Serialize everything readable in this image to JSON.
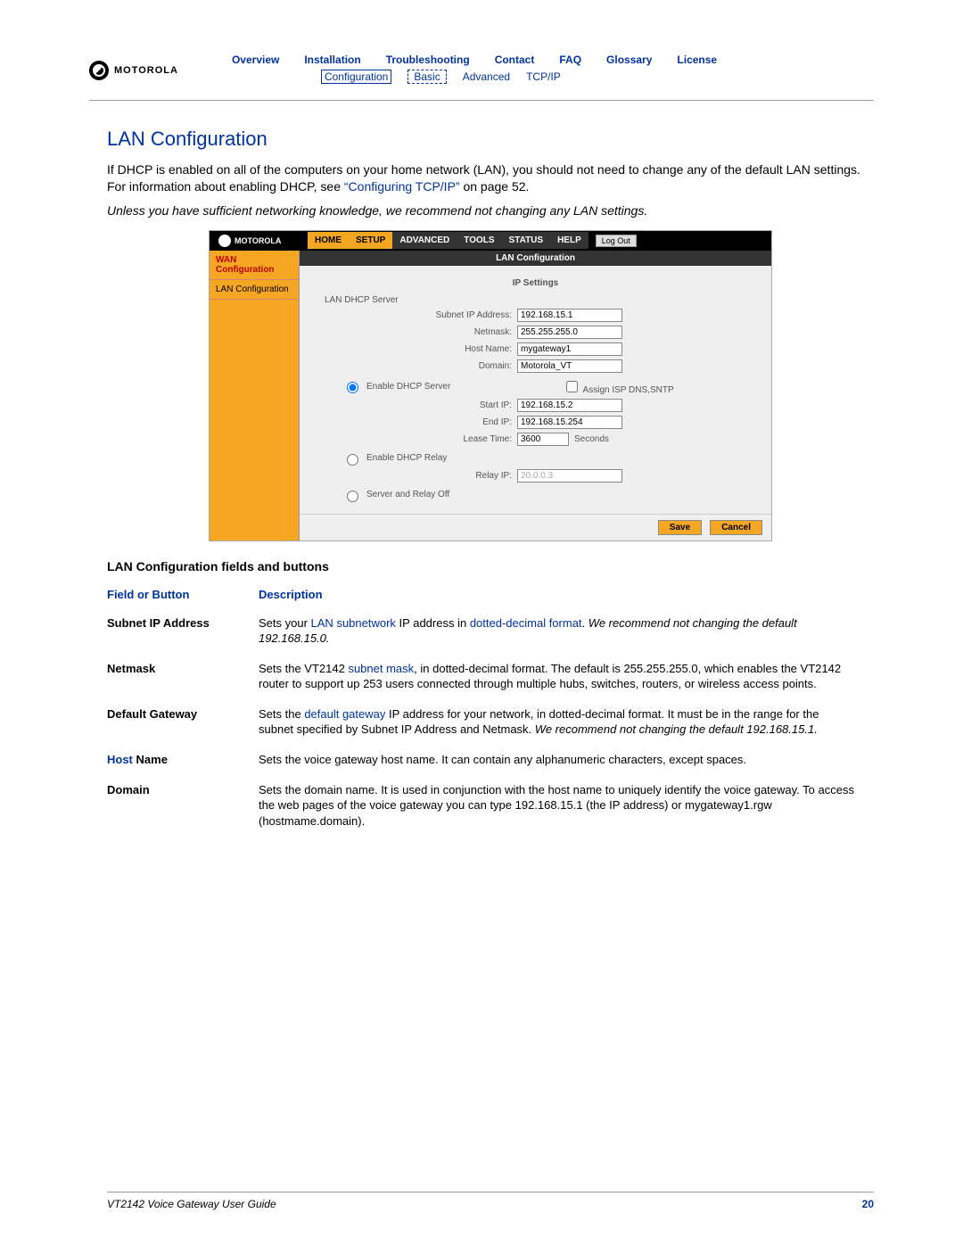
{
  "brand": "MOTOROLA",
  "nav": {
    "row1": [
      "Overview",
      "Installation",
      "Troubleshooting",
      "Contact",
      "FAQ",
      "Glossary",
      "License"
    ],
    "row2": {
      "configuration": "Configuration",
      "basic": "Basic",
      "advanced": "Advanced",
      "tcpip": "TCP/IP"
    }
  },
  "title": "LAN Configuration",
  "intro1a": "If DHCP is enabled on all of the computers on your home network (LAN), you should not need to change any of the default LAN settings. For information about enabling DHCP, see ",
  "intro1_link": "“Configuring TCP/IP”",
  "intro1b": " on page 52.",
  "intro2": "Unless you have sufficient networking knowledge, we recommend not changing any LAN settings.",
  "screenshot": {
    "brand": "MOTOROLA",
    "tabs": {
      "home": "HOME",
      "setup": "SETUP",
      "advanced": "ADVANCED",
      "tools": "TOOLS",
      "status": "STATUS",
      "help": "HELP"
    },
    "logout": "Log Out",
    "side": {
      "wan": "WAN Configuration",
      "lan": "LAN Configuration"
    },
    "panel_title": "LAN Configuration",
    "section1": "IP Settings",
    "lan_dhcp_server": "LAN DHCP Server",
    "labels": {
      "subnet": "Subnet IP Address:",
      "netmask": "Netmask:",
      "hostname": "Host Name:",
      "domain": "Domain:",
      "enable_server": "Enable DHCP Server",
      "assign": "Assign ISP DNS,SNTP",
      "startip": "Start IP:",
      "endip": "End IP:",
      "lease": "Lease Time:",
      "seconds": "Seconds",
      "enable_relay": "Enable DHCP Relay",
      "relayip": "Relay IP:",
      "serveroff": "Server and Relay Off"
    },
    "values": {
      "subnet": "192.168.15.1",
      "netmask": "255.255.255.0",
      "hostname": "mygateway1",
      "domain": "Motorola_VT",
      "startip": "192.168.15.2",
      "endip": "192.168.15.254",
      "lease": "3600",
      "relayip": "20.0.0.3"
    },
    "buttons": {
      "save": "Save",
      "cancel": "Cancel"
    }
  },
  "table_title": "LAN Configuration fields and buttons",
  "table_headers": {
    "c1": "Field or Button",
    "c2": "Description"
  },
  "rows": {
    "r1": {
      "name": "Subnet IP Address",
      "d1": "Sets your ",
      "link1": "LAN",
      "d2": " ",
      "link2": "subnetwork",
      "d3": " IP address in ",
      "link3": "dotted-decimal format",
      "d4": ". ",
      "ital": "We recommend not changing the default 192.168.15.0."
    },
    "r2": {
      "name": "Netmask",
      "d1": "Sets the VT2142 ",
      "link1": "subnet mask",
      "d2": ", in dotted-decimal format. The default is 255.255.255.0, which enables the VT2142 router to support up 253 users connected through multiple hubs, switches, routers, or wireless access points."
    },
    "r3": {
      "name": "Default Gateway",
      "d1": "Sets the ",
      "link1": "default gateway",
      "d2": " IP address for your network, in dotted-decimal format. It must be in the range for the subnet specified by Subnet IP Address and Netmask. ",
      "ital": "We recommend not changing the default 192.168.15.1."
    },
    "r4": {
      "name": "Host Name",
      "link": "Host",
      "d": "Sets the voice gateway host name. It can contain any alphanumeric characters, except spaces."
    },
    "r5": {
      "name": "Domain",
      "d": "Sets the domain name. It is used in conjunction with the host name to uniquely identify the voice gateway. To access the web pages of the voice gateway you can type 192.168.15.1 (the IP address) or mygateway1.rgw (hostmame.domain)."
    }
  },
  "footer": {
    "left": "VT2142 Voice Gateway User Guide",
    "page": "20"
  }
}
